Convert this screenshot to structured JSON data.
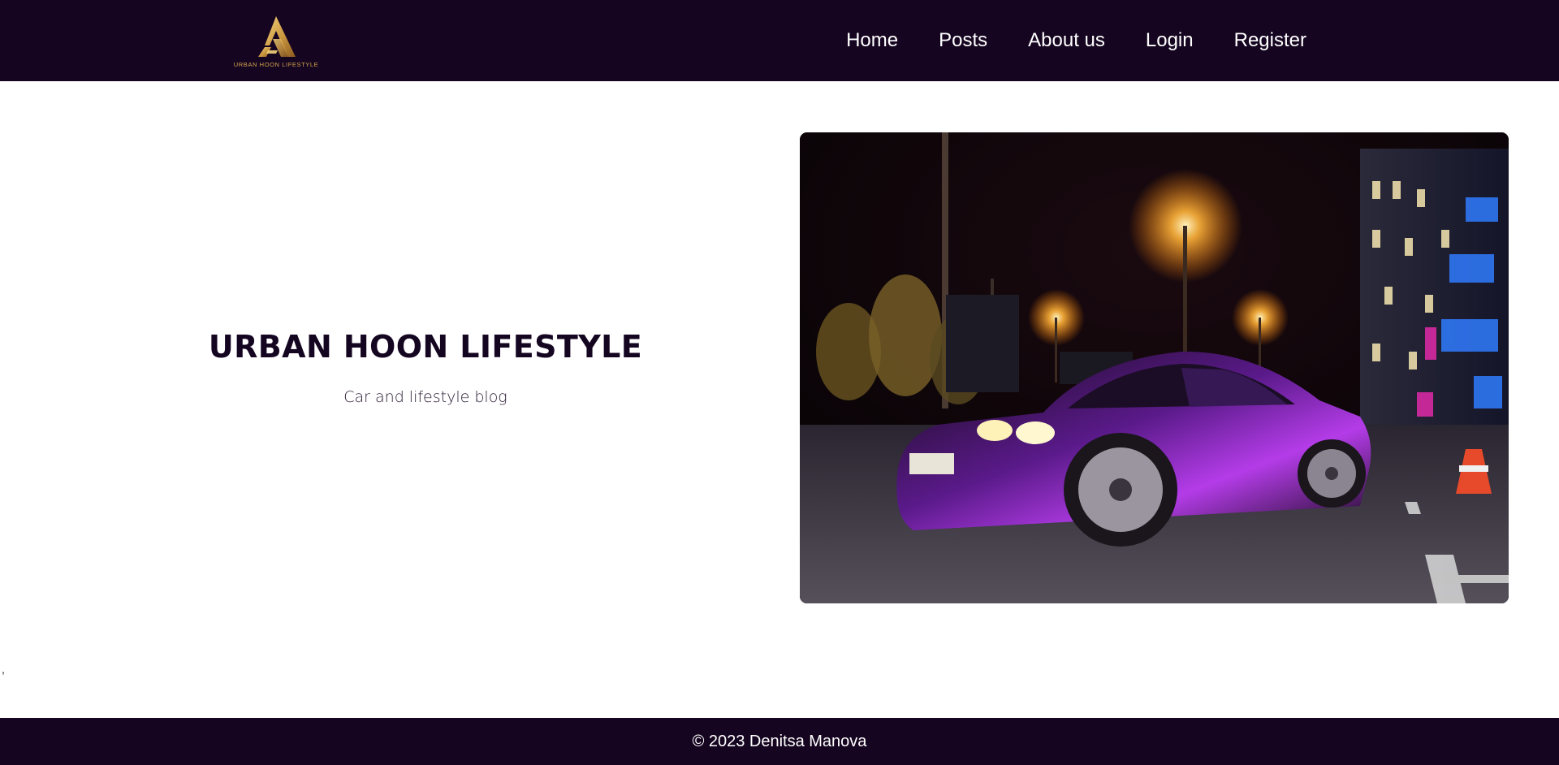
{
  "brand": {
    "logo_text": "URBAN HOON LIFESTYLE",
    "logo_icon": "ua-mountain-logo",
    "gold": "#d4a44e"
  },
  "nav": {
    "items": [
      {
        "label": "Home"
      },
      {
        "label": "Posts"
      },
      {
        "label": "About us"
      },
      {
        "label": "Login"
      },
      {
        "label": "Register"
      }
    ]
  },
  "hero": {
    "title": "URBAN HOON LIFESTYLE",
    "subtitle": "Car and lifestyle blog",
    "image": "night-city-car-photo"
  },
  "stray_text": ",",
  "footer": {
    "copyright": "© 2023 Denitsa Manova"
  },
  "colors": {
    "header_bg": "#150520",
    "footer_bg": "#150520",
    "text_dark": "#140521",
    "page_bg": "#ffffff"
  }
}
